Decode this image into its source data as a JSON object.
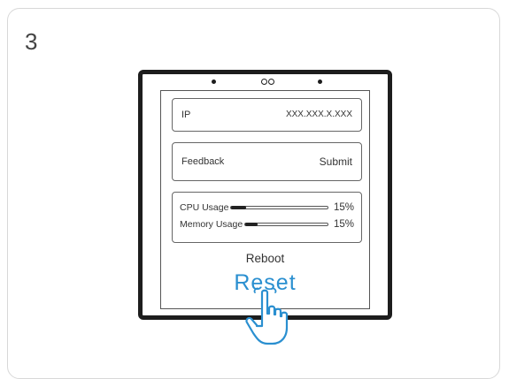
{
  "step": {
    "number": "3"
  },
  "device_screen": {
    "ip_row": {
      "label": "IP",
      "value": "XXX.XXX.X.XXX"
    },
    "feedback_row": {
      "label": "Feedback",
      "action": "Submit"
    },
    "usage": {
      "cpu": {
        "label": "CPU Usage",
        "percent_text": "15%",
        "fraction": 0.15
      },
      "memory": {
        "label": "Memory Usage",
        "percent_text": "15%",
        "fraction": 0.15
      }
    },
    "reboot_label": "Reboot",
    "reset_label": "Reset"
  },
  "colors": {
    "accent": "#2a8fd0",
    "frame": "#1d1d1d"
  },
  "icons": {
    "pointer": "hand-pointer-icon"
  }
}
